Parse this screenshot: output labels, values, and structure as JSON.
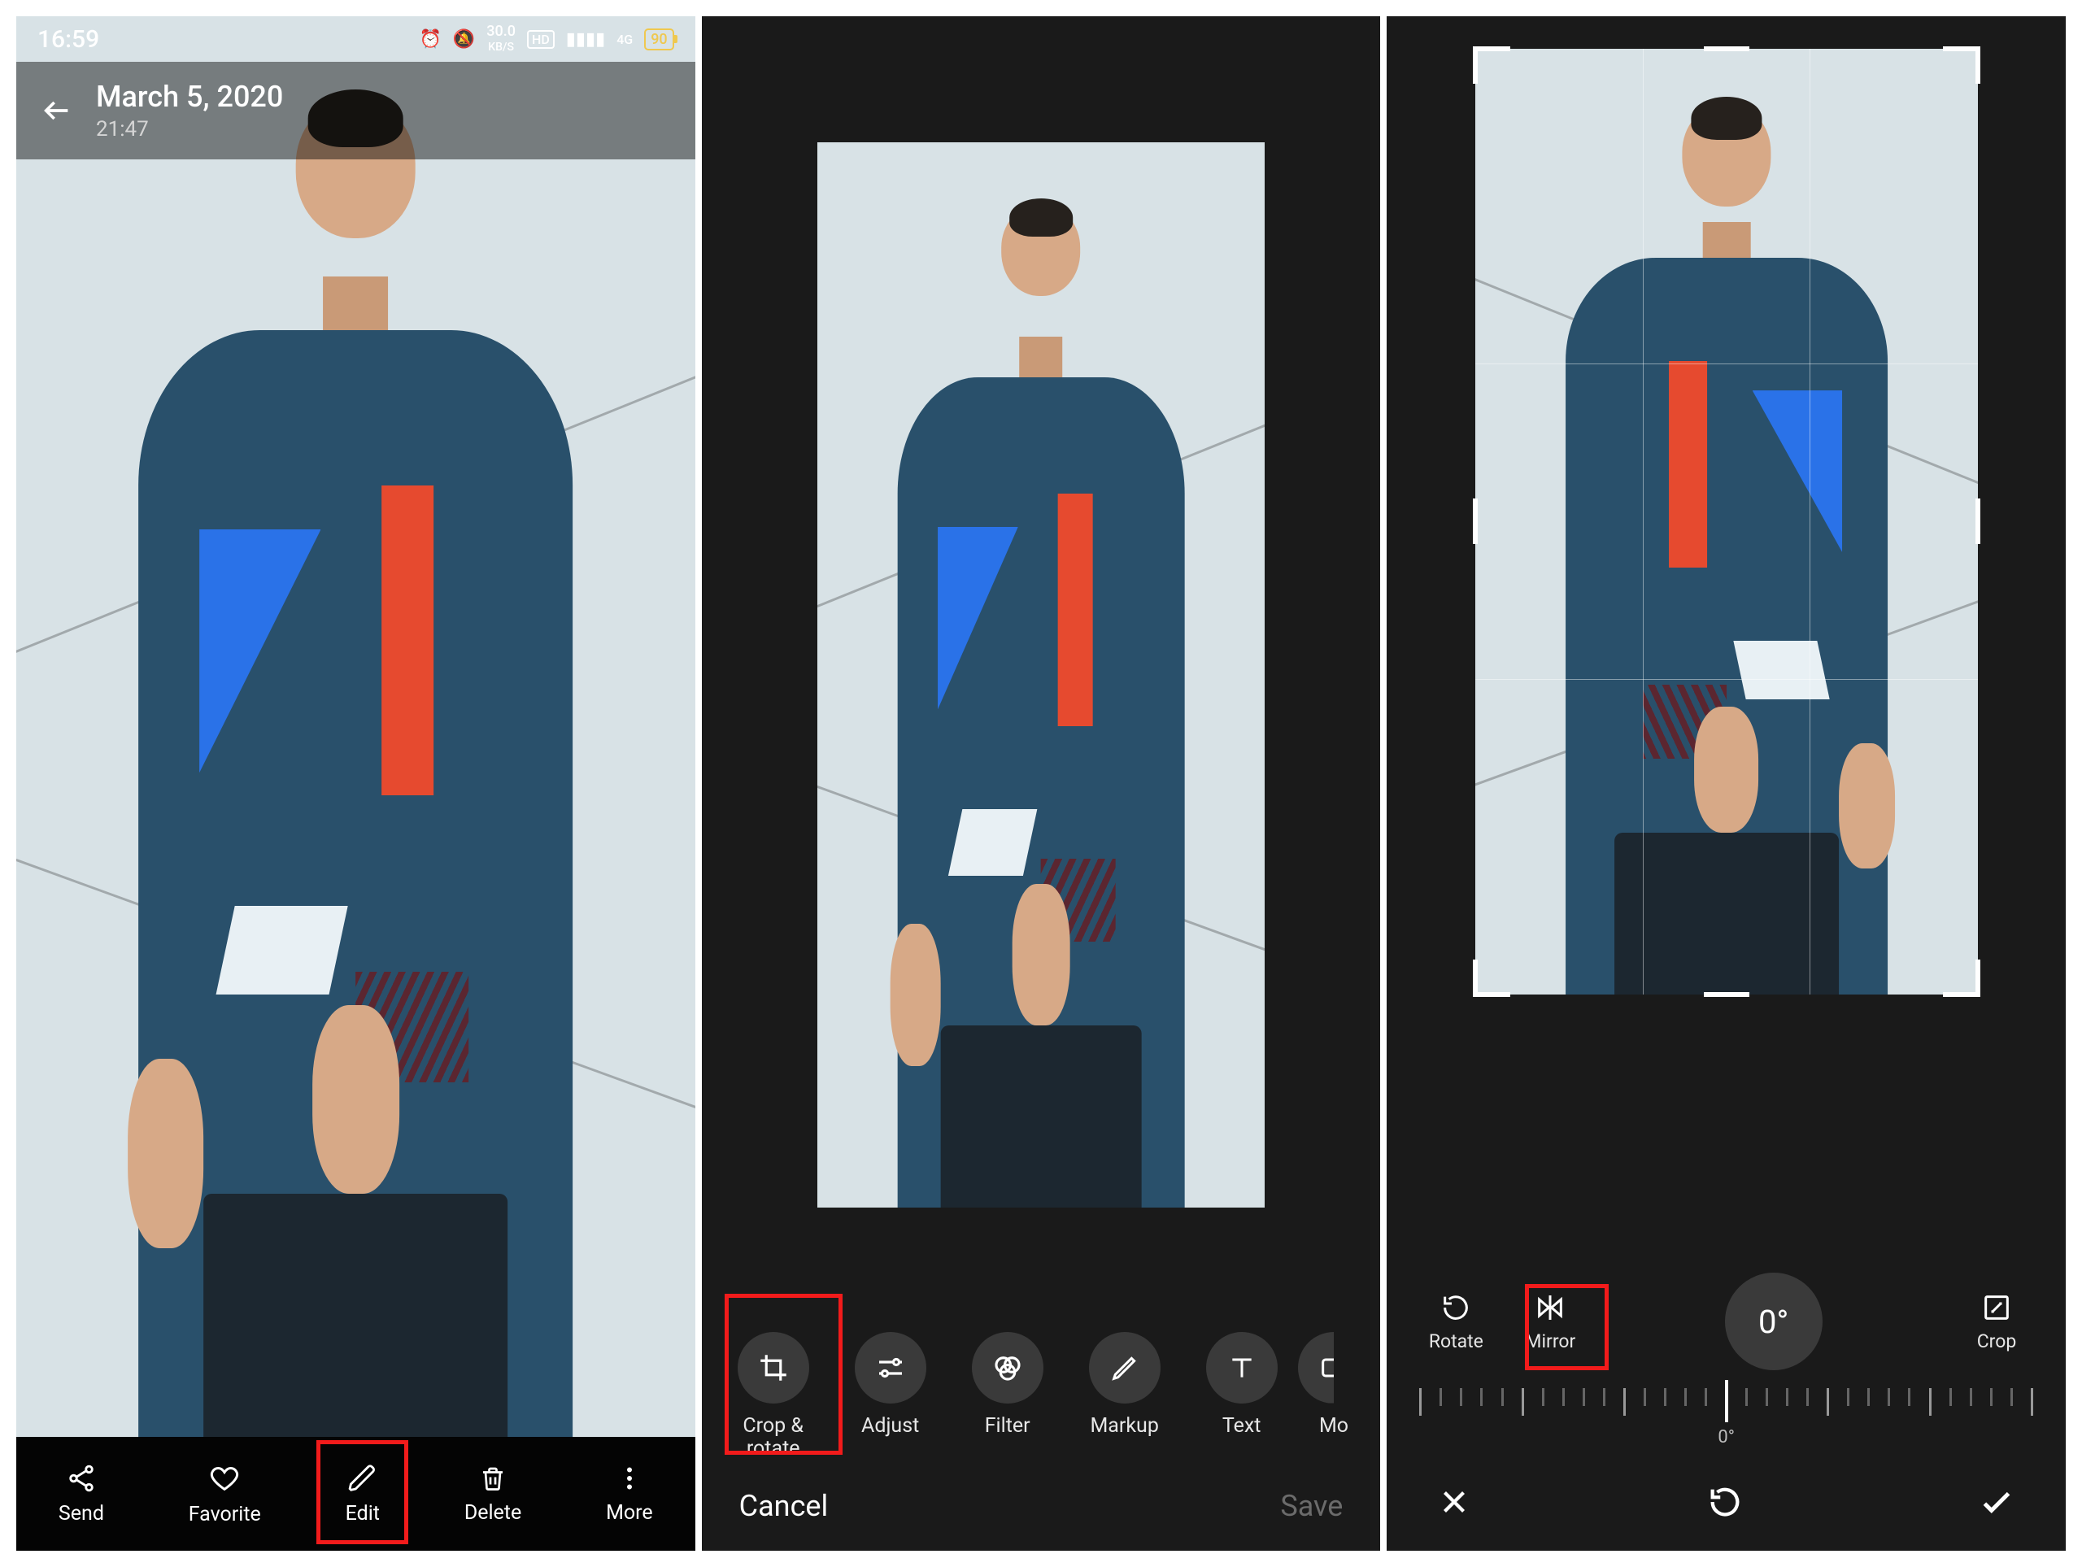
{
  "screen1": {
    "status": {
      "time": "16:59",
      "net_speed": "30.0",
      "net_unit": "KB/S",
      "hd": "HD",
      "net_type": "4G",
      "battery": "90"
    },
    "title": "March 5, 2020",
    "subtitle": "21:47",
    "actions": {
      "send": "Send",
      "favorite": "Favorite",
      "edit": "Edit",
      "delete": "Delete",
      "more": "More"
    }
  },
  "screen2": {
    "tools": {
      "crop_rotate": "Crop & rotate",
      "adjust": "Adjust",
      "filter": "Filter",
      "markup": "Markup",
      "text": "Text",
      "more_partial": "Mo"
    },
    "cancel": "Cancel",
    "save": "Save"
  },
  "screen3": {
    "rotate": "Rotate",
    "mirror": "Mirror",
    "angle": "0°",
    "ruler_label": "0°",
    "crop": "Crop"
  }
}
